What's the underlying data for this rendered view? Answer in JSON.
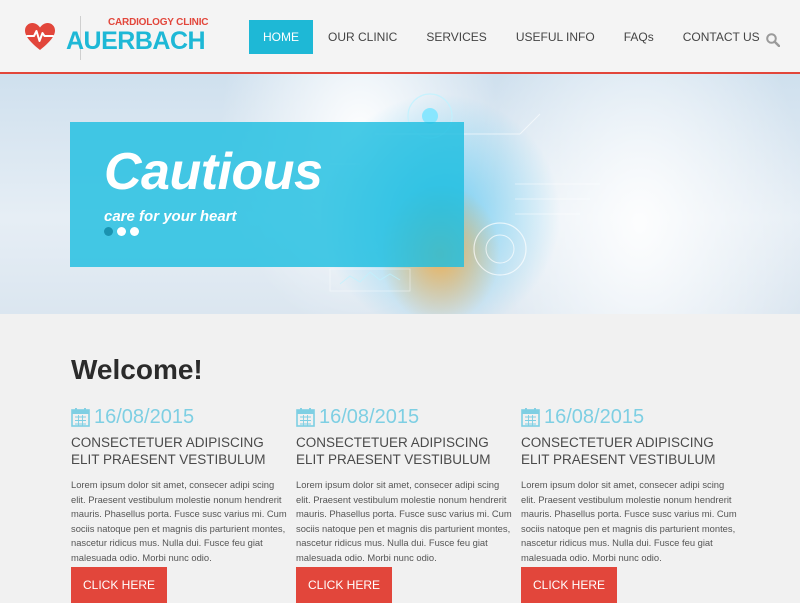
{
  "header": {
    "logo_sub": "CARDIOLOGY CLINIC",
    "logo_main": "AUERBACH",
    "nav": [
      {
        "label": "HOME"
      },
      {
        "label": "OUR CLINIC"
      },
      {
        "label": "SERVICES"
      },
      {
        "label": "USEFUL INFO"
      },
      {
        "label": "FAQs"
      },
      {
        "label": "CONTACT US"
      }
    ],
    "active_nav": "HOME",
    "search_icon": "search-icon"
  },
  "hero": {
    "title": "Cautious",
    "subtitle": "care for your heart",
    "slide_count": 3,
    "active_slide": 1
  },
  "main": {
    "welcome": "Welcome!",
    "columns": [
      {
        "date": "16/08/2015",
        "title": "CONSECTETUER ADIPISCING ELIT PRAESENT VESTIBULUM",
        "text": "Lorem ipsum dolor sit amet, consecer adipi scing elit. Praesent vestibulum molestie nonum hendrerit mauris. Phasellus porta. Fusce susc varius mi. Cum sociis natoque pen et magnis dis parturient montes, nascetur ridicus mus. Nulla dui. Fusce feu giat malesuada odio. Morbi nunc odio.",
        "button": "CLICK HERE"
      },
      {
        "date": "16/08/2015",
        "title": "CONSECTETUER ADIPISCING ELIT PRAESENT VESTIBULUM",
        "text": "Lorem ipsum dolor sit amet, consecer adipi scing elit. Praesent vestibulum molestie nonum hendrerit mauris. Phasellus porta. Fusce susc varius mi. Cum sociis natoque pen et magnis dis parturient montes, nascetur ridicus mus. Nulla dui. Fusce feu giat malesuada odio. Morbi nunc odio.",
        "button": "CLICK HERE"
      },
      {
        "date": "16/08/2015",
        "title": "CONSECTETUER ADIPISCING ELIT PRAESENT VESTIBULUM",
        "text": "Lorem ipsum dolor sit amet, consecer adipi scing elit. Praesent vestibulum molestie nonum hendrerit mauris. Phasellus porta. Fusce susc varius mi. Cum sociis natoque pen et magnis dis parturient montes, nascetur ridicus mus. Nulla dui. Fusce feu giat malesuada odio. Morbi nunc odio.",
        "button": "CLICK HERE"
      }
    ]
  },
  "colors": {
    "accent": "#1eb8d6",
    "brand_red": "#e2463b",
    "date_color": "#7ecfe3",
    "text_dark": "#2b2b2b"
  }
}
